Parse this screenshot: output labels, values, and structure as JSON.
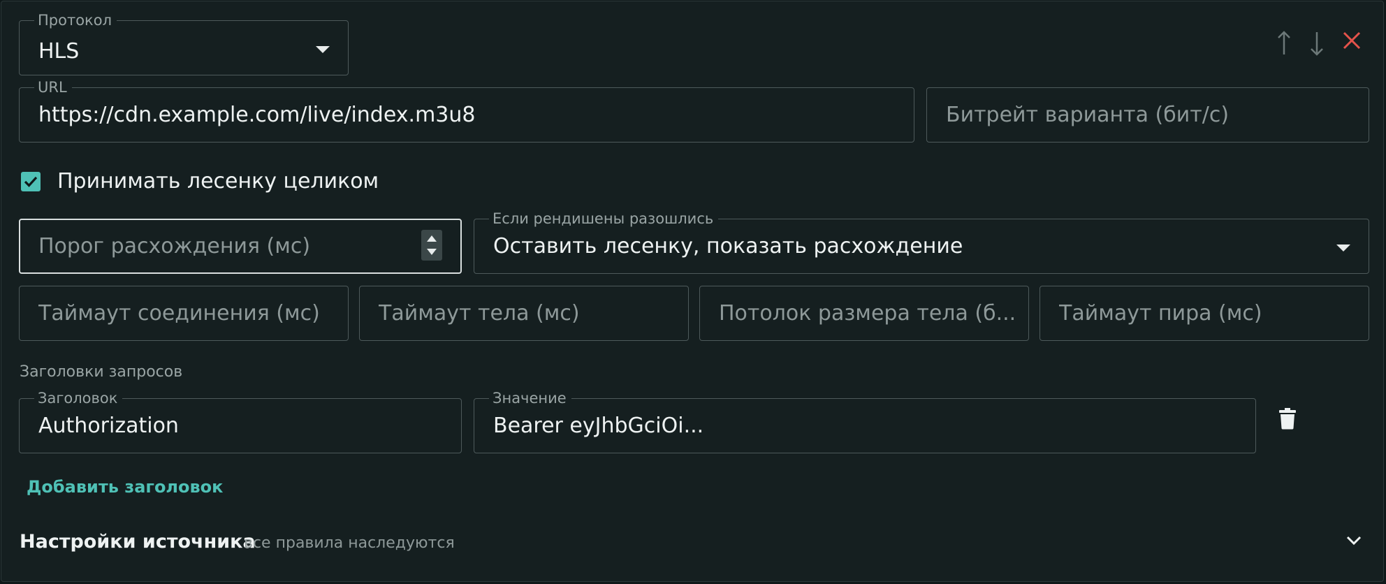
{
  "protocol": {
    "label": "Протокол",
    "value": "HLS"
  },
  "row_actions": {
    "move_up_icon": "arrow-up",
    "move_down_icon": "arrow-down",
    "remove_icon": "close-x",
    "remove_color": "#e5534b"
  },
  "url": {
    "label": "URL",
    "value": "https://cdn.example.com/live/index.m3u8"
  },
  "variant_bitrate": {
    "placeholder": "Битрейт варианта (бит/с)"
  },
  "accept_ladder": {
    "label": "Принимать лесенку целиком",
    "checked": true
  },
  "divergence_threshold": {
    "placeholder": "Порог расхождения (мс)"
  },
  "renditions_policy": {
    "label": "Если рендишены разошлись",
    "value": "Оставить лесенку, показать расхождение"
  },
  "timeouts": {
    "connect": "Таймаут соединения (мс)",
    "body": "Таймаут тела (мс)",
    "body_size_cap": "Потолок размера тела (б...",
    "peer": "Таймаут пира (мс)"
  },
  "request_headers": {
    "section_label": "Заголовки запросов",
    "header_label": "Заголовок",
    "header_value": "Authorization",
    "value_label": "Значение",
    "value_value": "Bearer eyJhbGciOi...",
    "delete_icon": "trash",
    "add_label": "Добавить заголовок"
  },
  "source_settings": {
    "title": "Настройки источника",
    "subtitle": "все правила наследуются",
    "expand_icon": "chevron-down"
  },
  "colors": {
    "accent": "#4fc1b6",
    "panel_bg": "#151f20",
    "field_border": "#4e5a5b",
    "danger": "#e5534b"
  }
}
